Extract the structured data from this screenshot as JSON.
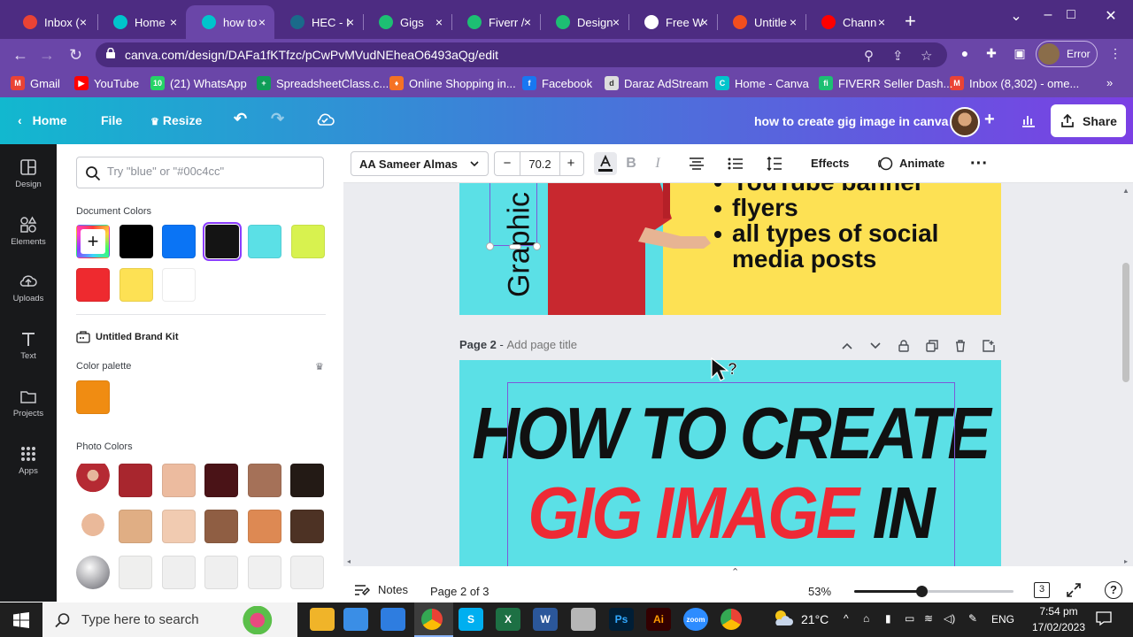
{
  "browser": {
    "tabs": [
      {
        "title": "Inbox (",
        "icon": "gmail-icon",
        "color": "#ea4335",
        "active": false
      },
      {
        "title": "Home",
        "icon": "canva-icon",
        "color": "#00c4cc",
        "active": false
      },
      {
        "title": "how to",
        "icon": "canva-icon",
        "color": "#00c4cc",
        "active": true
      },
      {
        "title": "HEC - I",
        "icon": "hec-icon",
        "color": "#1a6a8a",
        "active": false
      },
      {
        "title": "Gigs",
        "icon": "fiverr-icon",
        "color": "#1dbf73",
        "active": false
      },
      {
        "title": "Fiverr /",
        "icon": "fiverr-icon",
        "color": "#1dbf73",
        "active": false
      },
      {
        "title": "Design",
        "icon": "fiverr-icon",
        "color": "#1dbf73",
        "active": false
      },
      {
        "title": "Free W",
        "icon": "globe-icon",
        "color": "#ffffff",
        "active": false
      },
      {
        "title": "Untitle",
        "icon": "figma-icon",
        "color": "#f24e1e",
        "active": false
      },
      {
        "title": "Chann",
        "icon": "youtube-icon",
        "color": "#ff0000",
        "active": false
      }
    ],
    "url": "canva.com/design/DAFa1fKTfzc/pCwPvMVudNEheaO6493aQg/edit",
    "profile_label": "Error",
    "bookmarks": [
      {
        "label": "Gmail",
        "color": "#ea4335",
        "glyph": "M"
      },
      {
        "label": "YouTube",
        "color": "#ff0000",
        "glyph": "▶"
      },
      {
        "label": "(21) WhatsApp",
        "color": "#25d366",
        "glyph": "10"
      },
      {
        "label": "SpreadsheetClass.c...",
        "color": "#0f9d58",
        "glyph": "+"
      },
      {
        "label": "Online Shopping in...",
        "color": "#f57224",
        "glyph": "♦"
      },
      {
        "label": "Facebook",
        "color": "#1877f2",
        "glyph": "f"
      },
      {
        "label": "Daraz AdStream",
        "color": "#dddddd",
        "glyph": "d"
      },
      {
        "label": "Home - Canva",
        "color": "#00c4cc",
        "glyph": "C"
      },
      {
        "label": "FIVERR Seller Dash...",
        "color": "#1dbf73",
        "glyph": "fi"
      },
      {
        "label": "Inbox (8,302) - ome...",
        "color": "#ea4335",
        "glyph": "M"
      }
    ]
  },
  "canva": {
    "header": {
      "home": "Home",
      "file": "File",
      "resize": "Resize",
      "doc_title": "how to create gig image in canva",
      "share": "Share"
    },
    "rail": [
      {
        "label": "Design",
        "icon": "design-icon"
      },
      {
        "label": "Elements",
        "icon": "elements-icon"
      },
      {
        "label": "Uploads",
        "icon": "uploads-icon"
      },
      {
        "label": "Text",
        "icon": "text-icon"
      },
      {
        "label": "Projects",
        "icon": "projects-icon"
      },
      {
        "label": "Apps",
        "icon": "apps-icon"
      }
    ],
    "panel": {
      "search_placeholder": "Try \"blue\" or \"#00c4cc\"",
      "document_colors_label": "Document Colors",
      "document_colors": [
        "#000000",
        "#0a74f5",
        "#141414",
        "#5be0e6",
        "#d8f24f",
        "#ee2a2f",
        "#fde154",
        "#ffffff"
      ],
      "brand_kit_label": "Untitled Brand Kit",
      "color_palette_label": "Color palette",
      "palette_colors": [
        "#f08c12"
      ],
      "photo_colors_label": "Photo Colors",
      "photo_rows": [
        [
          "#a8262e",
          "#ecbb9f",
          "#4a1317",
          "#a57158",
          "#231a15"
        ],
        [
          "#e0ae84",
          "#f1cbb1",
          "#8f5e43",
          "#dd8953",
          "#4d3224"
        ],
        [
          "#efefee",
          "#efefef",
          "#efefef",
          "#f0f0f0",
          "#f0f0f0"
        ]
      ]
    },
    "toolbar": {
      "font": "AA Sameer Almas",
      "size": "70.2",
      "effects": "Effects",
      "animate": "Animate"
    },
    "page1": {
      "bullets": [
        "YouTube banner",
        "flyers",
        "all types of social",
        "media posts"
      ],
      "vertical_text": "Graphic"
    },
    "page2": {
      "label": "Page 2",
      "title_placeholder": "Add page title",
      "line1": "HOW TO CREATE",
      "line2_red": "GIG IMAGE",
      "line2_black": "IN"
    },
    "status": {
      "notes": "Notes",
      "page_of": "Page 2 of 3",
      "zoom": "53%",
      "zoom_fraction": 0.42,
      "page_count": "3"
    }
  },
  "taskbar": {
    "search_placeholder": "Type here to search",
    "temperature": "21°C",
    "lang": "ENG",
    "time": "7:54 pm",
    "date": "17/02/2023",
    "apps": [
      {
        "label": "",
        "icon": "file-explorer-icon",
        "color": "#f0b429"
      },
      {
        "label": "",
        "icon": "store-icon",
        "color": "#3a8ee6"
      },
      {
        "label": "",
        "icon": "mail-icon",
        "color": "#2e7de0"
      },
      {
        "label": "",
        "icon": "chrome-icon",
        "color": "#4285f4"
      },
      {
        "label": "S",
        "icon": "skype-icon",
        "color": "#00aff0"
      },
      {
        "label": "X",
        "icon": "excel-icon",
        "color": "#1d7044"
      },
      {
        "label": "W",
        "icon": "word-icon",
        "color": "#2b579a"
      },
      {
        "label": "",
        "icon": "paint-icon",
        "color": "#b6b6b6"
      },
      {
        "label": "Ps",
        "icon": "photoshop-icon",
        "color": "#001e36"
      },
      {
        "label": "Ai",
        "icon": "illustrator-icon",
        "color": "#330000"
      },
      {
        "label": "zoom",
        "icon": "zoom-icon",
        "color": "#2d8cff"
      },
      {
        "label": "",
        "icon": "chrome-icon",
        "color": "#4285f4"
      }
    ]
  }
}
